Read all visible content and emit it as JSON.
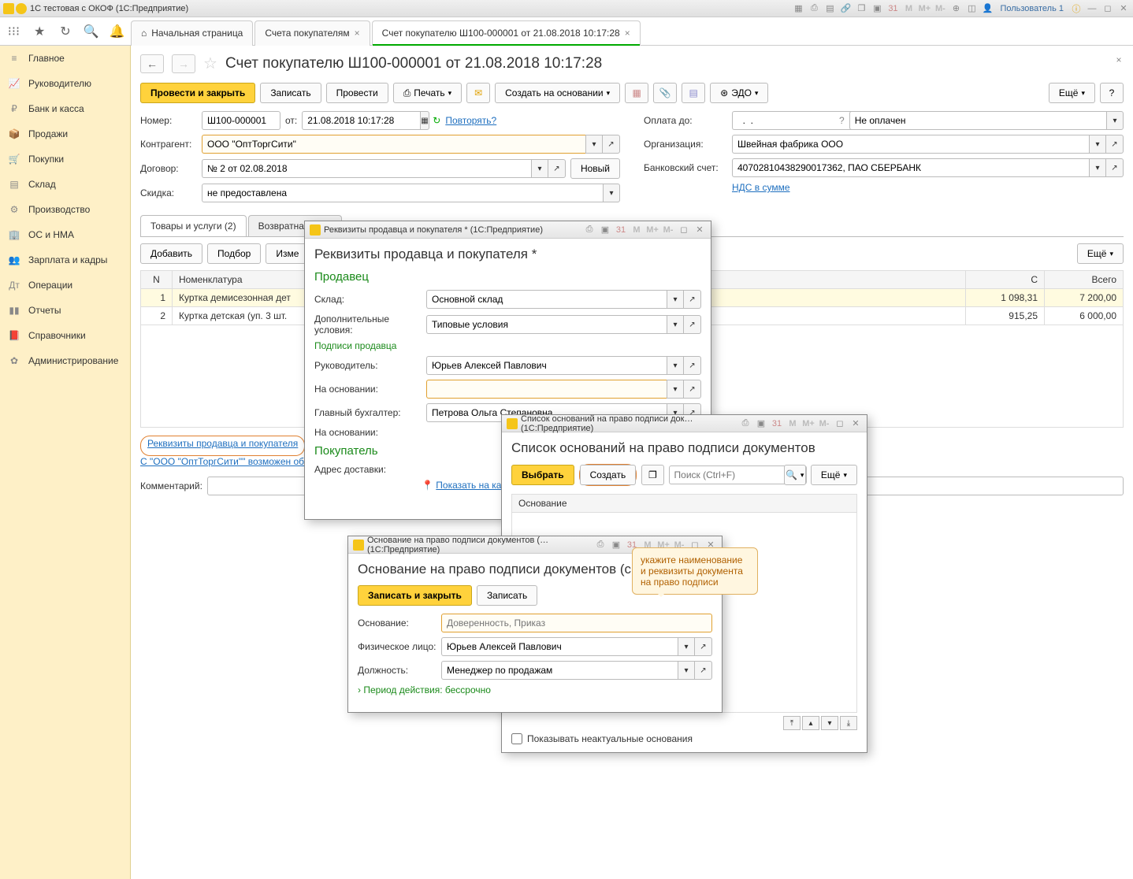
{
  "app": {
    "title": "1С тестовая с ОКОФ    (1С:Предприятие)",
    "user": "Пользователь 1"
  },
  "tabs": {
    "home": "Начальная страница",
    "invoices": "Счета покупателям",
    "current": "Счет покупателю Ш100-000001 от 21.08.2018 10:17:28"
  },
  "sidebar": {
    "items": [
      "Главное",
      "Руководителю",
      "Банк и касса",
      "Продажи",
      "Покупки",
      "Склад",
      "Производство",
      "ОС и НМА",
      "Зарплата и кадры",
      "Операции",
      "Отчеты",
      "Справочники",
      "Администрирование"
    ]
  },
  "doc": {
    "title": "Счет покупателю Ш100-000001 от 21.08.2018 10:17:28",
    "btn_post_close": "Провести и закрыть",
    "btn_write": "Записать",
    "btn_post": "Провести",
    "btn_print": "Печать",
    "btn_create_based": "Создать на основании",
    "btn_edo": "ЭДО",
    "btn_more": "Ещё",
    "num_lbl": "Номер:",
    "num": "Ш100-000001",
    "from_lbl": "от:",
    "date": "21.08.2018 10:17:28",
    "repeat": "Повторять?",
    "payto_lbl": "Оплата до:",
    "unpaid": "Не оплачен",
    "ctr_lbl": "Контрагент:",
    "ctr": "ООО \"ОптТоргСити\"",
    "org_lbl": "Организация:",
    "org": "Швейная фабрика ООО",
    "contract_lbl": "Договор:",
    "contract": "№ 2 от 02.08.2018",
    "btn_new": "Новый",
    "bank_lbl": "Банковский счет:",
    "bank": "40702810438290017362, ПАО СБЕРБАНК",
    "disc_lbl": "Скидка:",
    "disc": "не предоставлена",
    "vat_link": "НДС в сумме",
    "tab_goods": "Товары и услуги (2)",
    "tab_tare": "Возвратная тара",
    "btn_add": "Добавить",
    "btn_pick": "Подбор",
    "btn_change": "Изме",
    "col_n": "N",
    "col_nom": "Номенклатура",
    "col_c": "С",
    "col_total": "Всего",
    "rows": [
      {
        "n": "1",
        "nom": "Куртка демисезонная дет",
        "c": "1 098,31",
        "tot": "7 200,00"
      },
      {
        "n": "2",
        "nom": "Куртка детская (уп. 3 шт.",
        "c": "915,25",
        "tot": "6 000,00"
      }
    ],
    "link_req": "Реквизиты продавца и покупателя",
    "link_exchange": "С \"ООО \"ОптТоргСити\"\" возможен обмен",
    "comment_lbl": "Комментарий:"
  },
  "modal1": {
    "wintitle": "Реквизиты продавца и покупателя *   (1С:Предприятие)",
    "title": "Реквизиты продавца и покупателя *",
    "seller": "Продавец",
    "wh_lbl": "Склад:",
    "wh": "Основной склад",
    "addcond_lbl": "Дополнительные условия:",
    "addcond": "Типовые условия",
    "sign_h": "Подписи продавца",
    "mgr_lbl": "Руководитель:",
    "mgr": "Юрьев Алексей Павлович",
    "based_lbl": "На основании:",
    "acc_lbl": "Главный бухгалтер:",
    "acc": "Петрова Ольга Степановна",
    "based2_lbl": "На основании:",
    "buyer": "Покупатель",
    "addr_lbl": "Адрес доставки:",
    "show_map": "Показать на карт"
  },
  "modal2": {
    "wintitle": "Список оснований на право подписи док…   (1С:Предприятие)",
    "title": "Список оснований на право подписи документов",
    "btn_choose": "Выбрать",
    "btn_create": "Создать",
    "search_ph": "Поиск (Ctrl+F)",
    "btn_more": "Ещё",
    "col_reason": "Основание",
    "show_inactive": "Показывать неактуальные основания"
  },
  "modal3": {
    "wintitle": "Основание на право подписи документов (…   (1С:Предприятие)",
    "title": "Основание на право подписи документов (соз",
    "btn_write_close": "Записать и закрыть",
    "btn_write": "Записать",
    "reason_lbl": "Основание:",
    "reason_ph": "Доверенность, Приказ",
    "person_lbl": "Физическое лицо:",
    "person": "Юрьев Алексей Павлович",
    "pos_lbl": "Должность:",
    "pos": "Менеджер по продажам",
    "period": "Период действия: бессрочно",
    "callout": "укажите наименование и реквизиты документа на право подписи"
  }
}
